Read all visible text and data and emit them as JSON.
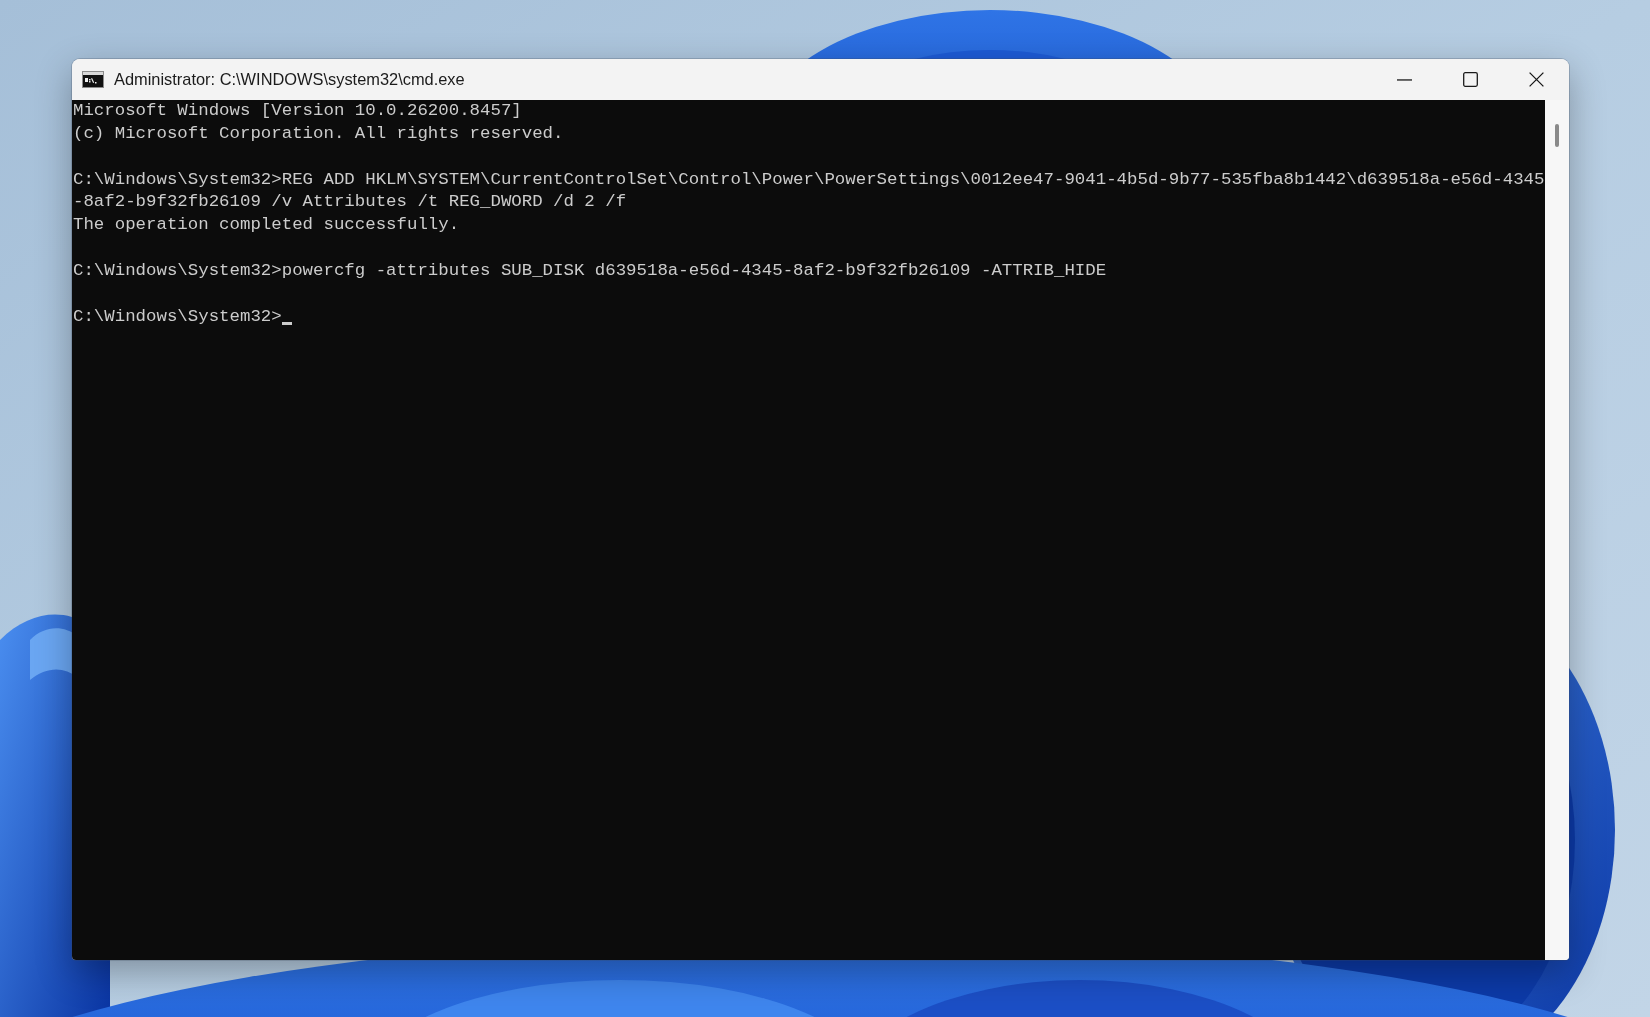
{
  "window": {
    "title": "Administrator: C:\\WINDOWS\\system32\\cmd.exe"
  },
  "console": {
    "cursor": true,
    "blocks": [
      {
        "lines": [
          "Microsoft Windows [Version 10.0.26200.8457]",
          "(c) Microsoft Corporation. All rights reserved."
        ]
      },
      {
        "lines": [
          "C:\\Windows\\System32>REG ADD HKLM\\SYSTEM\\CurrentControlSet\\Control\\Power\\PowerSettings\\0012ee47-9041-4b5d-9b77-535fba8b1442\\d639518a-e56d-4345",
          "-8af2-b9f32fb26109 /v Attributes /t REG_DWORD /d 2 /f",
          "The operation completed successfully."
        ]
      },
      {
        "lines": [
          "C:\\Windows\\System32>powercfg -attributes SUB_DISK d639518a-e56d-4345-8af2-b9f32fb26109 -ATTRIB_HIDE"
        ]
      },
      {
        "lines": [
          "C:\\Windows\\System32>"
        ]
      }
    ]
  }
}
